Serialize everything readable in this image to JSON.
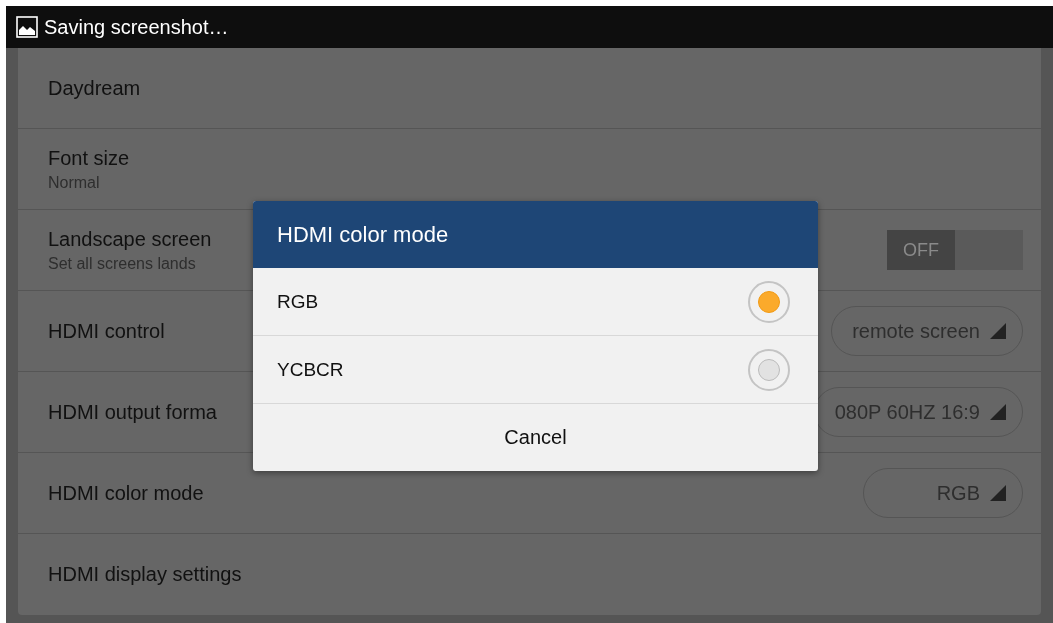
{
  "status_bar": {
    "notification": "Saving screenshot…"
  },
  "settings": [
    {
      "kind": "plain",
      "title": "Daydream"
    },
    {
      "kind": "plain",
      "title": "Font size",
      "summary": "Normal"
    },
    {
      "kind": "switch",
      "title": "Landscape screen",
      "summary": "Set all screens lands",
      "switch_label": "OFF",
      "on": false
    },
    {
      "kind": "dropdown",
      "title": "HDMI control",
      "value": "remote screen"
    },
    {
      "kind": "dropdown",
      "title": "HDMI output forma",
      "value": "080P 60HZ 16:9"
    },
    {
      "kind": "dropdown",
      "title": "HDMI color mode",
      "value": "RGB"
    },
    {
      "kind": "plain",
      "title": "HDMI display settings"
    }
  ],
  "dialog": {
    "title": "HDMI color mode",
    "options": [
      {
        "label": "RGB",
        "selected": true
      },
      {
        "label": "YCBCR",
        "selected": false
      }
    ],
    "cancel": "Cancel"
  }
}
